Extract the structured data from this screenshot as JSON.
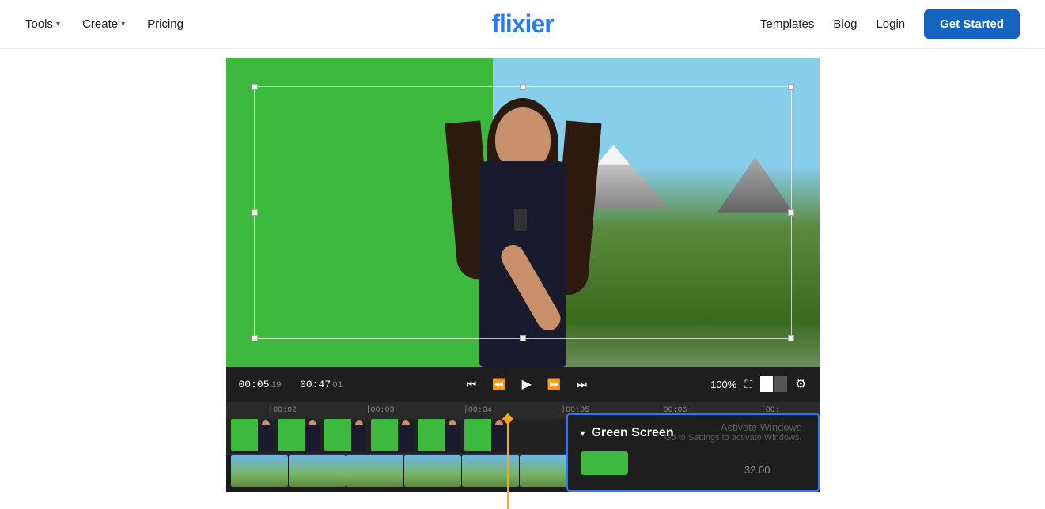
{
  "header": {
    "logo": "flixier",
    "nav": {
      "tools_label": "Tools",
      "create_label": "Create",
      "pricing_label": "Pricing",
      "templates_label": "Templates",
      "blog_label": "Blog",
      "login_label": "Login",
      "get_started_label": "Get Started"
    }
  },
  "video_controls": {
    "time_current": "00:05",
    "time_current_frame": "19",
    "time_total": "00:47",
    "time_total_frame": "01",
    "zoom_level": "100%"
  },
  "timeline": {
    "ruler_marks": [
      "|00:02",
      "|00:03",
      "|00:04",
      "|00:05",
      "|00:06",
      "|00:"
    ]
  },
  "green_screen_panel": {
    "title": "Green Screen",
    "value": "32.00"
  },
  "activate_windows": {
    "title": "Activate Windows",
    "subtitle": "Go to Settings to activate Windows."
  }
}
